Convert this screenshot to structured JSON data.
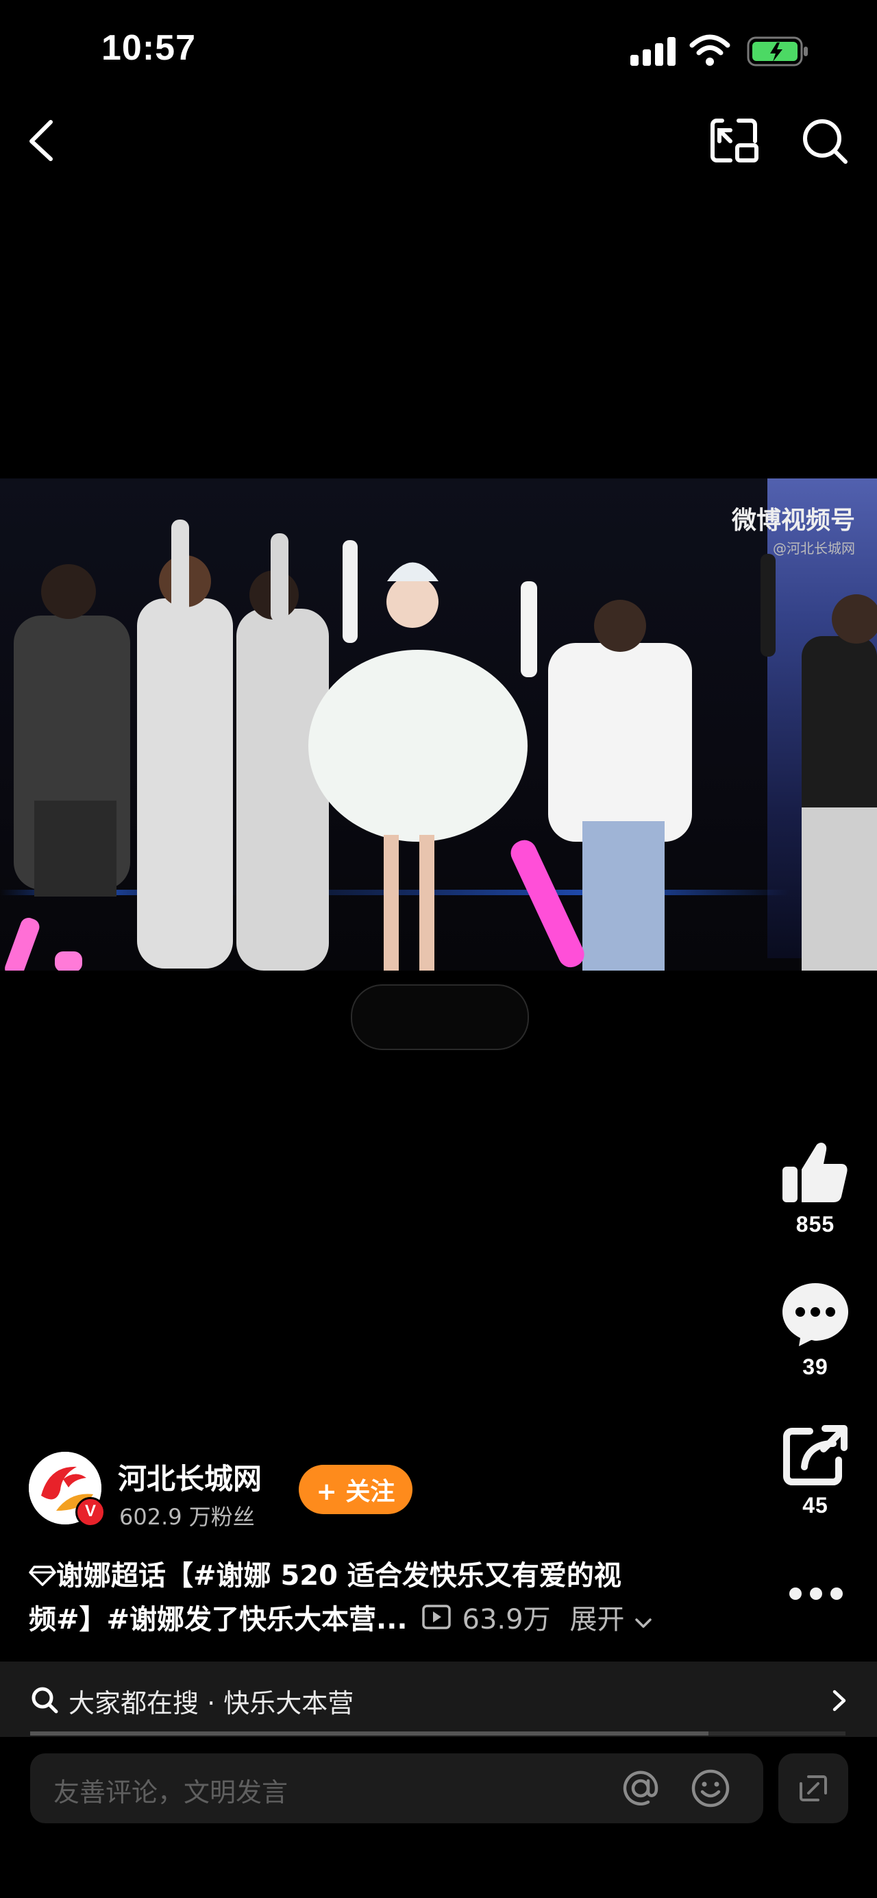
{
  "status_bar": {
    "time": "10:57"
  },
  "video": {
    "watermark_main": "微博视频号",
    "watermark_sub": "@河北长城网"
  },
  "actions": {
    "like_count": "855",
    "comment_count": "39",
    "share_count": "45"
  },
  "author": {
    "name": "河北长城网",
    "fans": "602.9 万粉丝",
    "follow_label": "+ 关注"
  },
  "caption": {
    "line1": "谢娜超话【#谢娜 520 适合发快乐又有爱的视",
    "line2": "频#】#谢娜发了快乐大本营...",
    "views": "63.9万",
    "expand": "展开"
  },
  "search_suggestion": {
    "text": "大家都在搜 · 快乐大本营"
  },
  "comment": {
    "placeholder": "友善评论，文明发言"
  },
  "colors": {
    "accent": "#fe8b1c",
    "background": "#000000",
    "panel": "#1c1c1c",
    "badge": "#e8222a"
  },
  "icons": [
    "back-icon",
    "pip-icon",
    "search-icon",
    "like-icon",
    "comment-icon",
    "share-icon",
    "more-icon",
    "at-icon",
    "emoji-icon",
    "expand-icon",
    "chevron-right-icon",
    "play-icon",
    "chevron-down-icon",
    "diamond-icon"
  ]
}
